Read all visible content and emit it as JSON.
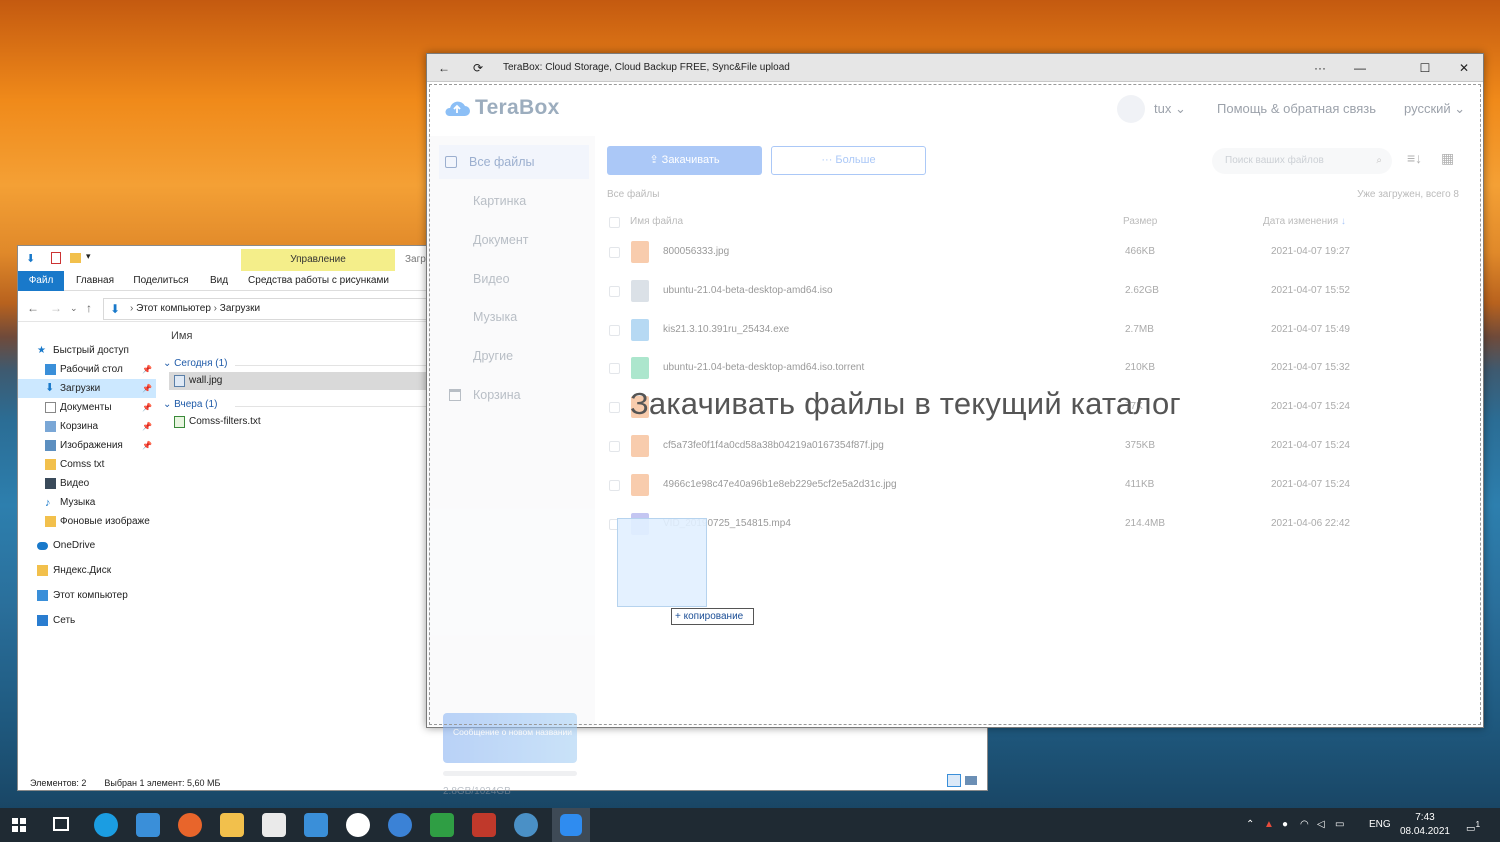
{
  "explorer": {
    "ribbon_context": "Управление",
    "ribbon_context2": "Загр",
    "tabs": [
      "Файл",
      "Главная",
      "Поделиться",
      "Вид",
      "Средства работы с рисунками"
    ],
    "path": [
      "Этот компьютер",
      "Загрузки"
    ],
    "nav": [
      {
        "label": "Быстрый доступ",
        "top": true
      },
      {
        "label": "Рабочий стол",
        "pin": true
      },
      {
        "label": "Загрузки",
        "pin": true,
        "selected": true
      },
      {
        "label": "Документы",
        "pin": true
      },
      {
        "label": "Корзина",
        "pin": true
      },
      {
        "label": "Изображения",
        "pin": true
      },
      {
        "label": "Comss txt"
      },
      {
        "label": "Видео"
      },
      {
        "label": "Музыка"
      },
      {
        "label": "Фоновые изображе"
      },
      {
        "label": "OneDrive",
        "top": true
      },
      {
        "label": "Яндекс.Диск",
        "top": true
      },
      {
        "label": "Этот компьютер",
        "top": true
      },
      {
        "label": "Сеть",
        "top": true
      }
    ],
    "column_name": "Имя",
    "groups": [
      {
        "label": "Сегодня (1)",
        "files": [
          "wall.jpg"
        ]
      },
      {
        "label": "Вчера (1)",
        "files": [
          "Comss-filters.txt"
        ]
      }
    ],
    "status_items": "Элементов: 2",
    "status_selected": "Выбран 1 элемент: 5,60 МБ"
  },
  "terabox": {
    "window_title": "TeraBox: Cloud Storage, Cloud Backup FREE, Sync&File upload",
    "menu_dots": "···",
    "logo": "TeraBox",
    "user": "tux",
    "help": "Помощь & обратная связь",
    "language": "русский",
    "sidebar": [
      "Все файлы",
      "Картинка",
      "Документ",
      "Видео",
      "Музыка",
      "Другие",
      "Корзина"
    ],
    "promo": "Сообщение о новом названии",
    "quota": "2.8GB/1024GB",
    "upload_button": "Закачивать",
    "more_button": "··· Больше",
    "search_placeholder": "Поиск ваших файлов",
    "breadcrumb": "Все файлы",
    "loaded_count": "Уже загружен, всего 8",
    "columns": {
      "name": "Имя файла",
      "size": "Размер",
      "date": "Дата изменения"
    },
    "files": [
      {
        "name": "800056333.jpg",
        "size": "466KB",
        "date": "2021-04-07 19:27",
        "type": "image"
      },
      {
        "name": "ubuntu-21.04-beta-desktop-amd64.iso",
        "size": "2.62GB",
        "date": "2021-04-07 15:52",
        "type": "disc"
      },
      {
        "name": "kis21.3.10.391ru_25434.exe",
        "size": "2.7MB",
        "date": "2021-04-07 15:49",
        "type": "app"
      },
      {
        "name": "ubuntu-21.04-beta-desktop-amd64.iso.torrent",
        "size": "210KB",
        "date": "2021-04-07 15:32",
        "type": "torrent"
      },
      {
        "name": "",
        "size": "77K",
        "date": "2021-04-07 15:24",
        "type": "image"
      },
      {
        "name": "cf5a73fe0f1f4a0cd58a38b04219a0167354f87f.jpg",
        "size": "375KB",
        "date": "2021-04-07 15:24",
        "type": "image"
      },
      {
        "name": "4966c1e98c47e40a96b1e8eb229e5cf2e5a2d31c.jpg",
        "size": "411KB",
        "date": "2021-04-07 15:24",
        "type": "image"
      },
      {
        "name": "VID_20190725_154815.mp4",
        "size": "214.4MB",
        "date": "2021-04-06 22:42",
        "type": "video"
      }
    ],
    "drop_overlay": "Закачивать файлы в текущий каталог",
    "copy_tip": "+ копирование"
  },
  "taskbar": {
    "lang": "ENG",
    "time": "7:43",
    "date": "08.04.2021",
    "notif": "1"
  },
  "colors": {
    "accent": "#5a93f0",
    "file_tab": "#1979ca",
    "ribbon_context": "#f4ee8a"
  }
}
